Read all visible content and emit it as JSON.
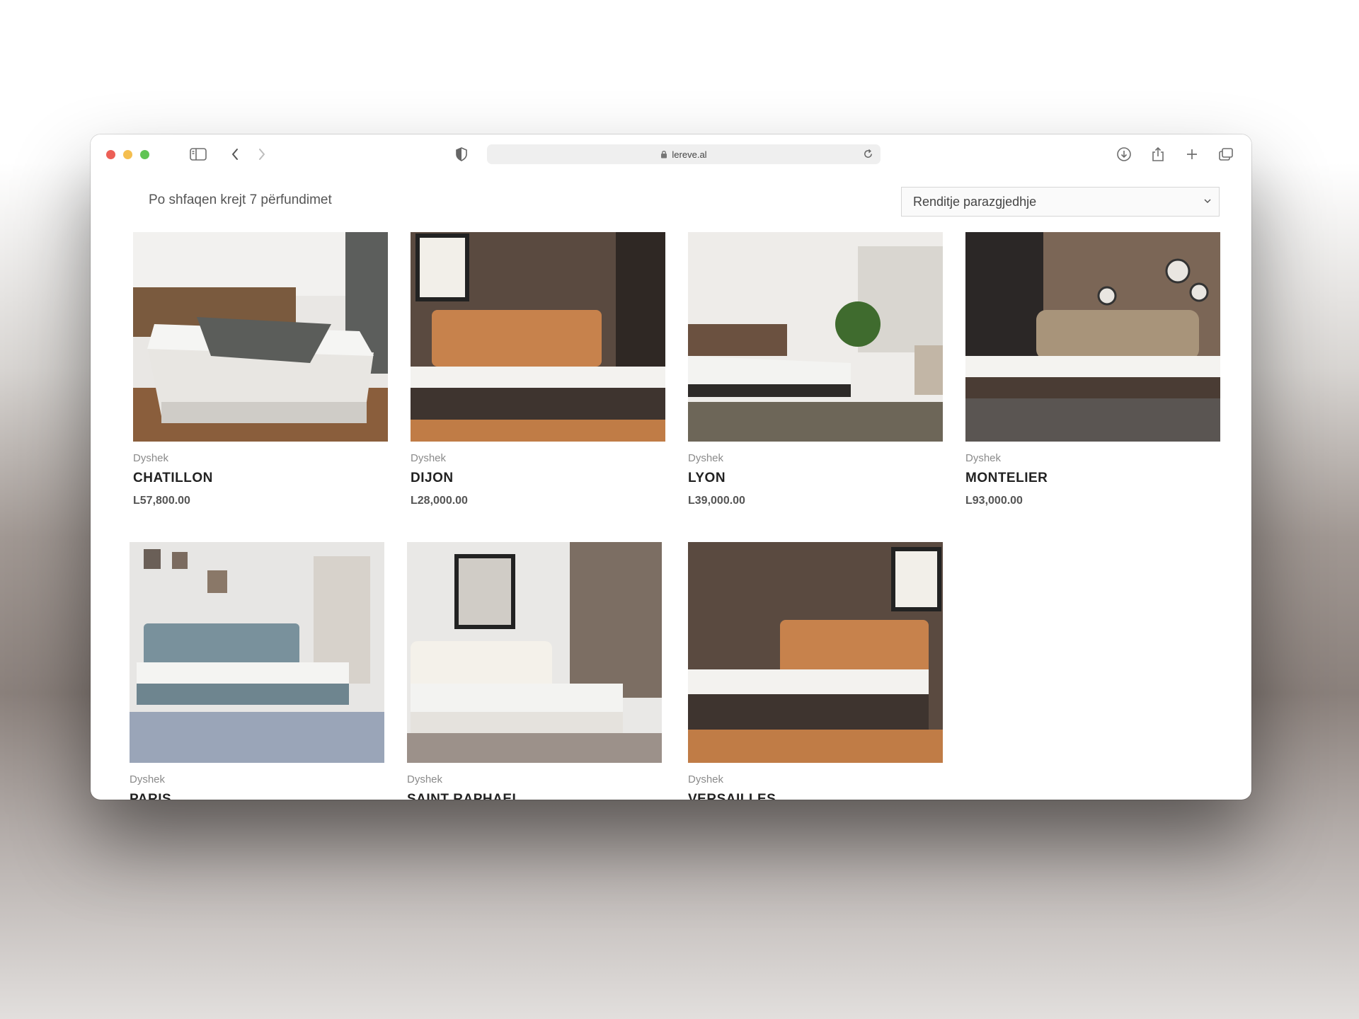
{
  "browser": {
    "url": "lereve.al"
  },
  "shop": {
    "result_count": "Po shfaqen krejt 7 përfundimet",
    "sort_selected": "Renditje parazgjedhje"
  },
  "products": [
    {
      "category": "Dyshek",
      "name": "CHATILLON",
      "price": "L57,800.00"
    },
    {
      "category": "Dyshek",
      "name": "DIJON",
      "price": "L28,000.00"
    },
    {
      "category": "Dyshek",
      "name": "LYON",
      "price": "L39,000.00"
    },
    {
      "category": "Dyshek",
      "name": "MONTELIER",
      "price": "L93,000.00"
    },
    {
      "category": "Dyshek",
      "name": "PARIS"
    },
    {
      "category": "Dyshek",
      "name": "SAINT RAPHAEL"
    },
    {
      "category": "Dyshek",
      "name": "VERSAILLES"
    }
  ],
  "icons": [
    "sidebar-icon",
    "back-chevron-icon",
    "forward-chevron-icon",
    "privacy-shield-icon",
    "lock-icon",
    "reload-icon",
    "download-icon",
    "share-icon",
    "new-tab-plus-icon",
    "tab-overview-icon",
    "sort-chevron-icon"
  ]
}
